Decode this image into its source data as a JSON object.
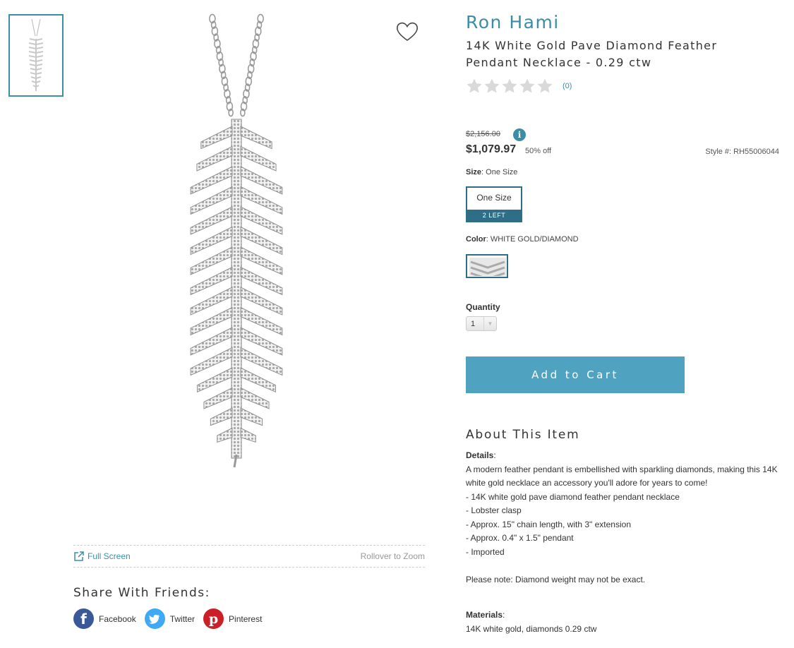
{
  "thumbnails": [
    {
      "alt": "Feather pendant necklace thumbnail"
    }
  ],
  "gallery": {
    "full_screen_label": "Full Screen",
    "rollover_label": "Rollover to Zoom"
  },
  "share": {
    "title": "Share With Friends:",
    "items": [
      {
        "label": "Facebook",
        "icon": "facebook-icon",
        "color": "#3b5998"
      },
      {
        "label": "Twitter",
        "icon": "twitter-icon",
        "color": "#3fa9f5"
      },
      {
        "label": "Pinterest",
        "icon": "pinterest-icon",
        "color": "#cb2027"
      }
    ]
  },
  "product": {
    "brand": "Ron Hami",
    "title": "14K White Gold Pave Diamond Feather Pendant Necklace - 0.29 ctw",
    "rating": 0,
    "review_count": "(0)",
    "original_price": "$2,156.00",
    "sale_price": "$1,079.97",
    "discount": "50% off",
    "style": "Style #: RH55006044",
    "size_label": "Size",
    "size_value": "One Size",
    "size_option": "One Size",
    "size_stock": "2 LEFT",
    "color_label": "Color",
    "color_value": "WHITE GOLD/DIAMOND",
    "quantity_label": "Quantity",
    "quantity_value": "1",
    "add_to_cart": "Add to Cart"
  },
  "about": {
    "title": "About This Item",
    "details_label": "Details",
    "description": "A modern feather pendant is embellished with sparkling diamonds, making this 14K white gold necklace an accessory you'll adore for years to come!",
    "bullets": [
      "- 14K white gold pave diamond feather pendant necklace",
      "- Lobster clasp",
      "- Approx. 15\" chain length, with 3\" extension",
      "- Approx. 0.4\" x 1.5\" pendant",
      "- Imported"
    ],
    "note": "Please note: Diamond weight may not be exact.",
    "materials_label": "Materials",
    "materials": "14K white gold, diamonds 0.29 ctw"
  },
  "colors": {
    "accent": "#3b8ea5",
    "cart": "#4fa3c1",
    "selected_border": "#2e6f87"
  }
}
